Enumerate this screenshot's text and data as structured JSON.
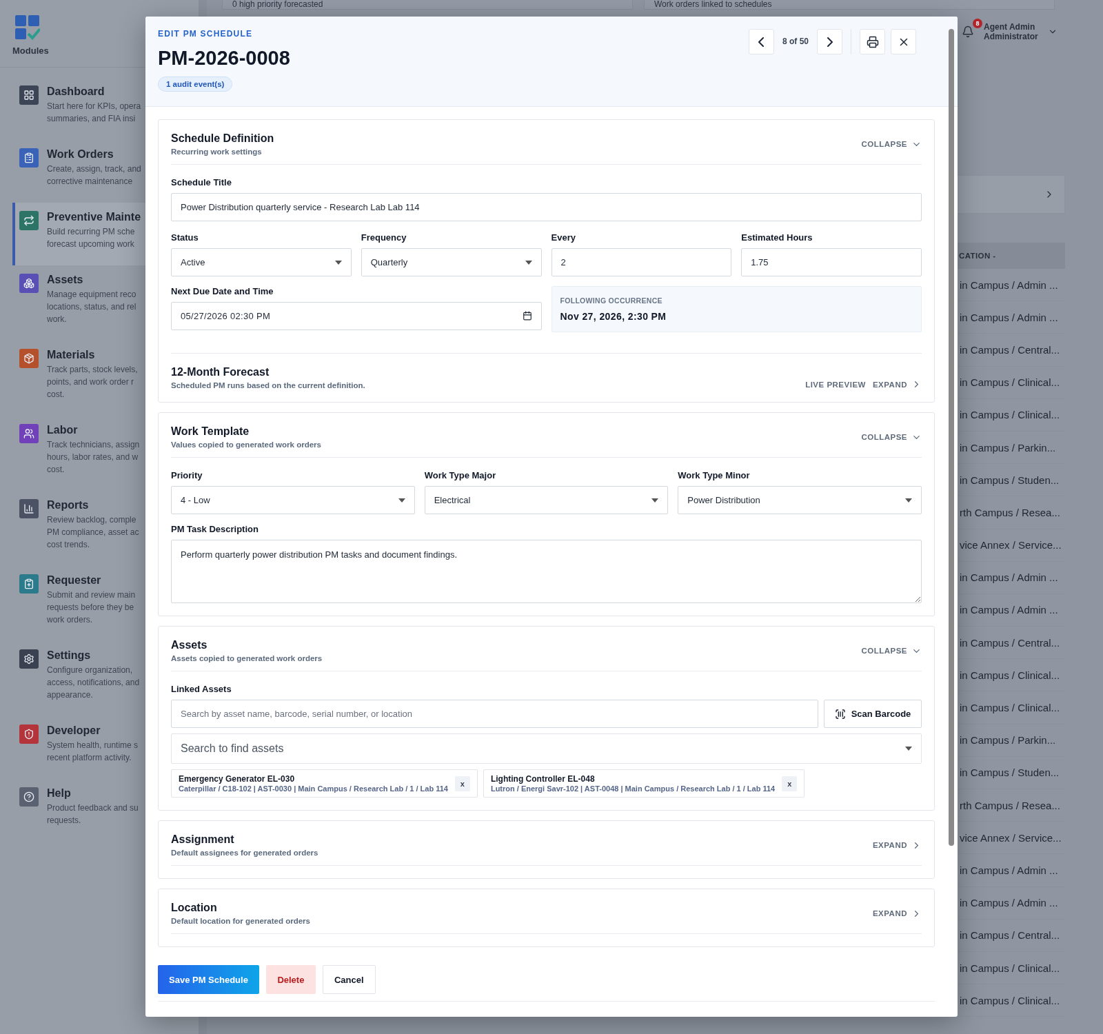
{
  "sidebar": {
    "heading": "Modules",
    "items": [
      {
        "title": "Dashboard",
        "description": [
          "Start here for KPIs, opera",
          "summaries, and FIA insi"
        ],
        "color": "#3c4555",
        "selected": false
      },
      {
        "title": "Work Orders",
        "description": [
          "Create, assign, track, and",
          "corrective maintenance"
        ],
        "color": "#3a63b8",
        "selected": false
      },
      {
        "title": "Preventive Mainte",
        "description": [
          "Build recurring PM sche",
          "forecast upcoming work"
        ],
        "color": "#2c7566",
        "selected": true
      },
      {
        "title": "Assets",
        "description": [
          "Manage equipment reco",
          "locations, status, and rel",
          "work."
        ],
        "color": "#5a4fb5",
        "selected": false
      },
      {
        "title": "Materials",
        "description": [
          "Track parts, stock levels,",
          "points, and work order r",
          "cost."
        ],
        "color": "#b4512c",
        "selected": false
      },
      {
        "title": "Labor",
        "description": [
          "Track technicians, assign",
          "hours, labor rates, and w",
          "cost."
        ],
        "color": "#7041b8",
        "selected": false
      },
      {
        "title": "Reports",
        "description": [
          "Review backlog, comple",
          "PM compliance, asset ac",
          "cost trends."
        ],
        "color": "#4a5263",
        "selected": false
      },
      {
        "title": "Requester",
        "description": [
          "Submit and review main",
          "requests before they be",
          "work orders."
        ],
        "color": "#2b7b8c",
        "selected": false
      },
      {
        "title": "Settings",
        "description": [
          "Configure organization,",
          "access, notifications, and",
          "appearance."
        ],
        "color": "#3a4252",
        "selected": false
      },
      {
        "title": "Developer",
        "description": [
          "System health, runtime s",
          "recent platform activity."
        ],
        "color": "#b3343b",
        "selected": false
      },
      {
        "title": "Help",
        "description": [
          "Product feedback and su",
          "requests."
        ],
        "color": "#5a6272",
        "selected": false
      }
    ]
  },
  "background": {
    "top_cards": [
      "0 high priority forecasted",
      "Work orders linked to schedules"
    ],
    "user": {
      "notification_count": "8",
      "name": "Agent Admin",
      "role": "Administrator"
    },
    "table": {
      "column": "CATION -",
      "rows": [
        "in Campus / Admin ...",
        "in Campus / Admin ...",
        "in Campus / Central...",
        "in Campus / Clinical...",
        "in Campus / Clinical...",
        "in Campus / Parkin...",
        "in Campus / Studen...",
        "rth Campus / Resea...",
        "vice Annex / Service...",
        "in Campus / Admin ...",
        "in Campus / Admin ...",
        "in Campus / Central...",
        "in Campus / Clinical...",
        "in Campus / Clinical...",
        "in Campus / Parkin...",
        "in Campus / Studen...",
        "rth Campus / Resea...",
        "vice Annex / Service...",
        "in Campus / Admin ...",
        "in Campus / Admin ...",
        "in Campus / Central...",
        "in Campus / Clinical...",
        "in Campus / Clinical..."
      ]
    }
  },
  "modal": {
    "eyebrow": "EDIT PM SCHEDULE",
    "title": "PM-2026-0008",
    "audit_badge": "1 audit event(s)",
    "pager": "8 of 50",
    "sections": [
      {
        "kind": "schedule",
        "title": "Schedule Definition",
        "subtitle": "Recurring work settings",
        "toggle": "COLLAPSE",
        "expanded": true,
        "schedule_title": {
          "label": "Schedule Title",
          "value": "Power Distribution quarterly service - Research Lab Lab 114"
        },
        "status": {
          "label": "Status",
          "value": "Active"
        },
        "frequency": {
          "label": "Frequency",
          "value": "Quarterly"
        },
        "every": {
          "label": "Every",
          "value": "2"
        },
        "estimated_hours": {
          "label": "Estimated Hours",
          "value": "1.75"
        },
        "next_due": {
          "label": "Next Due Date and Time",
          "value": "05/27/2026 02:30 PM"
        },
        "following": {
          "label": "FOLLOWING OCCURRENCE",
          "value": "Nov 27, 2026, 2:30 PM"
        },
        "forecast": {
          "title": "12-Month Forecast",
          "subtitle": "Scheduled PM runs based on the current definition.",
          "badge": "LIVE PREVIEW",
          "toggle": "EXPAND",
          "expanded": false
        }
      },
      {
        "kind": "template",
        "title": "Work Template",
        "subtitle": "Values copied to generated work orders",
        "toggle": "COLLAPSE",
        "expanded": true,
        "selects": [
          {
            "label": "Priority",
            "value": "4 - Low"
          },
          {
            "label": "Work Type Major",
            "value": "Electrical"
          },
          {
            "label": "Work Type Minor",
            "value": "Power Distribution"
          }
        ],
        "description": {
          "label": "PM Task Description",
          "value": "Perform quarterly power distribution PM tasks and document findings."
        }
      },
      {
        "kind": "assets",
        "title": "Assets",
        "subtitle": "Assets copied to generated work orders",
        "toggle": "COLLAPSE",
        "expanded": true,
        "linked_label": "Linked Assets",
        "search": {
          "placeholder": "Search by asset name, barcode, serial number, or location"
        },
        "scan_button": "Scan Barcode",
        "picker": {
          "placeholder": "Search to find assets"
        },
        "chips": [
          {
            "name": "Emergency Generator EL-030",
            "detail": "Caterpillar / C18-102 | AST-0030 | Main Campus / Research Lab / 1 / Lab 114",
            "remove": "x"
          },
          {
            "name": "Lighting Controller EL-048",
            "detail": "Lutron / Energi Savr-102 | AST-0048 | Main Campus / Research Lab / 1 / Lab 114",
            "remove": "x"
          }
        ]
      },
      {
        "kind": "plain",
        "title": "Assignment",
        "subtitle": "Default assignees for generated orders",
        "toggle": "EXPAND",
        "expanded": false
      },
      {
        "kind": "plain",
        "title": "Location",
        "subtitle": "Default location for generated orders",
        "toggle": "EXPAND",
        "expanded": false
      }
    ],
    "actions": [
      {
        "label": "Save PM Schedule",
        "kind": "primary"
      },
      {
        "label": "Delete",
        "kind": "danger"
      },
      {
        "label": "Cancel",
        "kind": "neutral"
      }
    ]
  }
}
